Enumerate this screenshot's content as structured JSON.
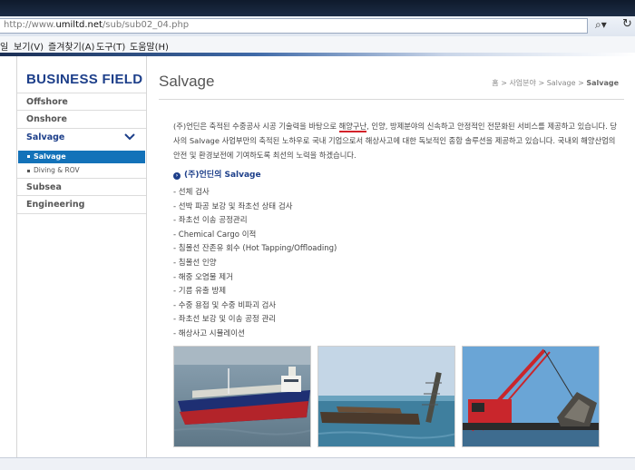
{
  "browser": {
    "url_prefix": "http://www.",
    "url_domain": "umiltd.net",
    "url_path": "/sub/sub02_04.php",
    "menu": [
      "보기(V)",
      "즐겨찾기(A)",
      "도구(T)",
      "도움말(H)"
    ],
    "menu_cut": "일"
  },
  "sidebar": {
    "title": "BUSINESS FIELD",
    "items": [
      {
        "label": "Offshore"
      },
      {
        "label": "Onshore"
      },
      {
        "label": "Salvage"
      },
      {
        "label": "Subsea"
      },
      {
        "label": "Engineering"
      }
    ],
    "subitems": [
      {
        "label": "Salvage"
      },
      {
        "label": "Diving & ROV"
      }
    ]
  },
  "main": {
    "title": "Salvage",
    "breadcrumb": {
      "home": "홈",
      "sep": ">",
      "level1": "사업분야",
      "level2": "Salvage",
      "current": "Salvage"
    },
    "intro": {
      "part1": "(주)언딘은 축적된 수중공사 시공 기술력을 바탕으로 ",
      "highlight": "해양구난",
      "part2": ", 인양, 방제분야의 신속하고 안정적인 전문화된 서비스를 제공하고 있습니다. 당사의 Salvage 사업부만의 축적된 노하우로 국내 기업으로서 해상사고에 대한 독보적인 종합 솔루션을 제공하고 있습니다. 국내외 해양산업의 안전 및 환경보전에 기여하도록 최선의 노력을 하겠습니다."
    },
    "section_heading": "(주)언딘의 Salvage",
    "section_bullet": "›",
    "services": [
      "- 선체 검사",
      "- 선박 파공 보강 및 좌초선 상태 검사",
      "- 좌초선 이송 공정관리",
      "- Chemical Cargo 이적",
      "- 침몰선 잔존유 회수 (Hot Tapping/Offloading)",
      "- 침몰선 인양",
      "- 해중 오염물 제거",
      "- 기름 유출 방제",
      "- 수중 용접 및 수중 비파괴 검사",
      "- 좌초선 보강 및 이송 공정 관리",
      "- 해상사고 시뮬레이션"
    ]
  },
  "colors": {
    "accent": "#1d3f8a",
    "active_sub": "#1372b9",
    "highlight_underline": "#d3222a"
  }
}
